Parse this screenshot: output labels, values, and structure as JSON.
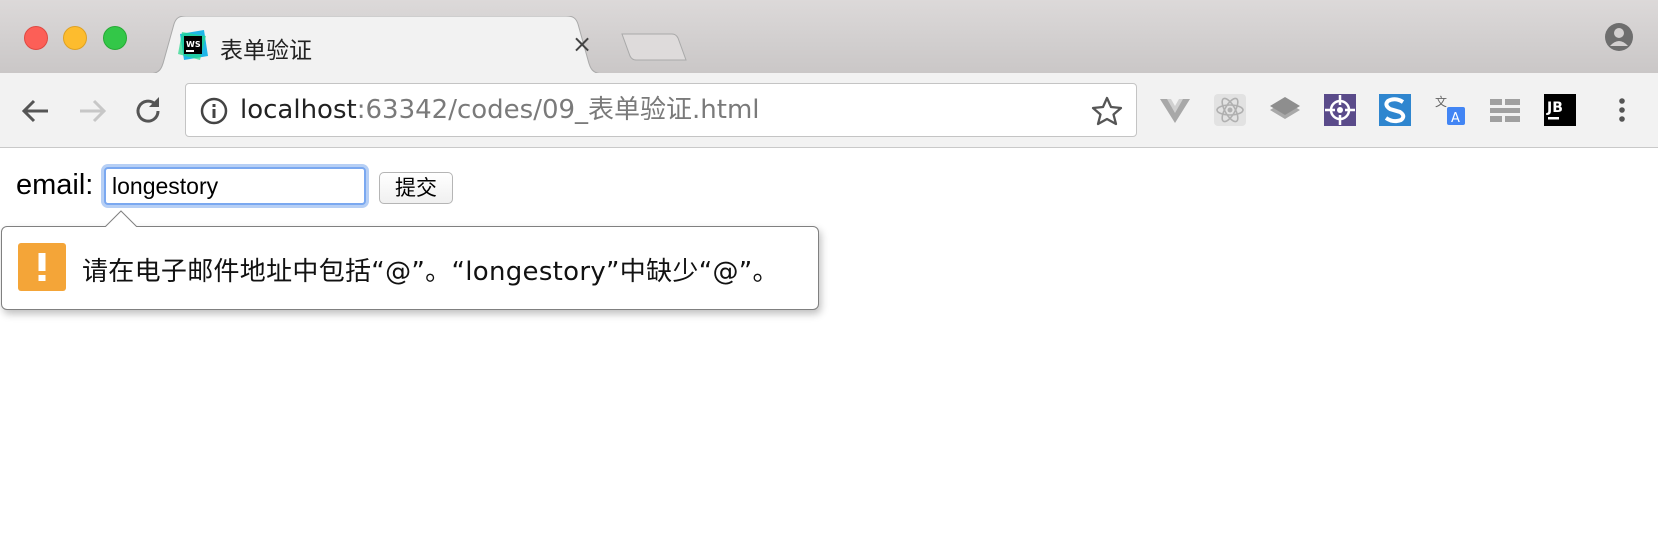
{
  "tab": {
    "title": "表单验证",
    "close_label": "×"
  },
  "address_bar": {
    "host": "localhost",
    "path": ":63342/codes/09_表单验证.html"
  },
  "toolbar": {
    "icons": [
      "back-icon",
      "forward-icon",
      "reload-icon",
      "info-icon",
      "bookmark-star-icon",
      "vue-devtools-icon",
      "react-devtools-icon",
      "layers-icon",
      "gallery-icon",
      "s-extension-icon",
      "translate-icon",
      "grid-extension-icon",
      "jetbrains-icon",
      "menu-icon"
    ],
    "jetbrains_label": "JB"
  },
  "form": {
    "email_label": "email:",
    "email_value": "longestory",
    "submit_label": "提交"
  },
  "validation": {
    "icon_glyph": "!",
    "message": "请在电子邮件地址中包括“@”。“longestory”中缺少“@”。"
  },
  "colors": {
    "focus_ring": "#7aa8f0",
    "warning": "#f4a538"
  }
}
